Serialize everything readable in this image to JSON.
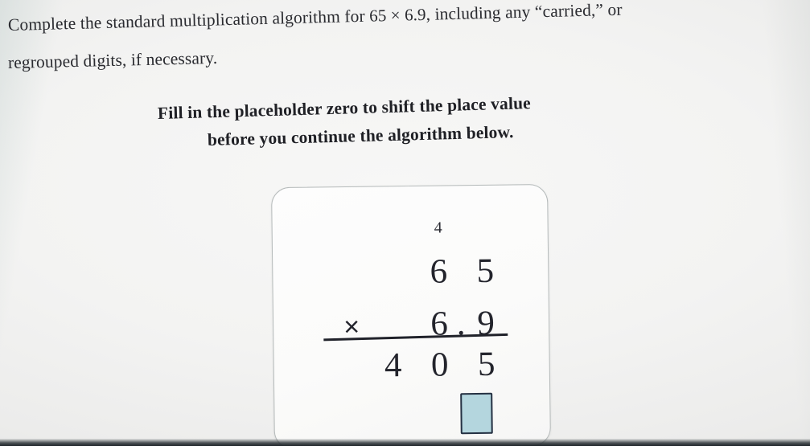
{
  "page": {
    "background_color": "#f3f3f2",
    "card_color": "#fbfbfa"
  },
  "prompt": {
    "line1_before": "Complete the standard multiplication algorithm for ",
    "line1_expression": "65 × 6.9",
    "line1_after": ", including any “carried,” or",
    "line2": "regrouped digits, if necessary."
  },
  "instruction": {
    "line1": "Fill in the placeholder zero to shift the place value",
    "line2": "before you continue the algorithm below."
  },
  "algorithm": {
    "carry_digit": "4",
    "multiplicand": {
      "tens": "6",
      "ones": "5"
    },
    "operator": "×",
    "multiplier": {
      "ones": "6",
      "decimal_point": ".",
      "tenths": "9"
    },
    "partial_product": {
      "hundreds": "4",
      "tens": "0",
      "ones": "5"
    },
    "answer_box": {
      "value": "",
      "fill_color": "#b4d6de",
      "border_color": "#243042"
    }
  }
}
